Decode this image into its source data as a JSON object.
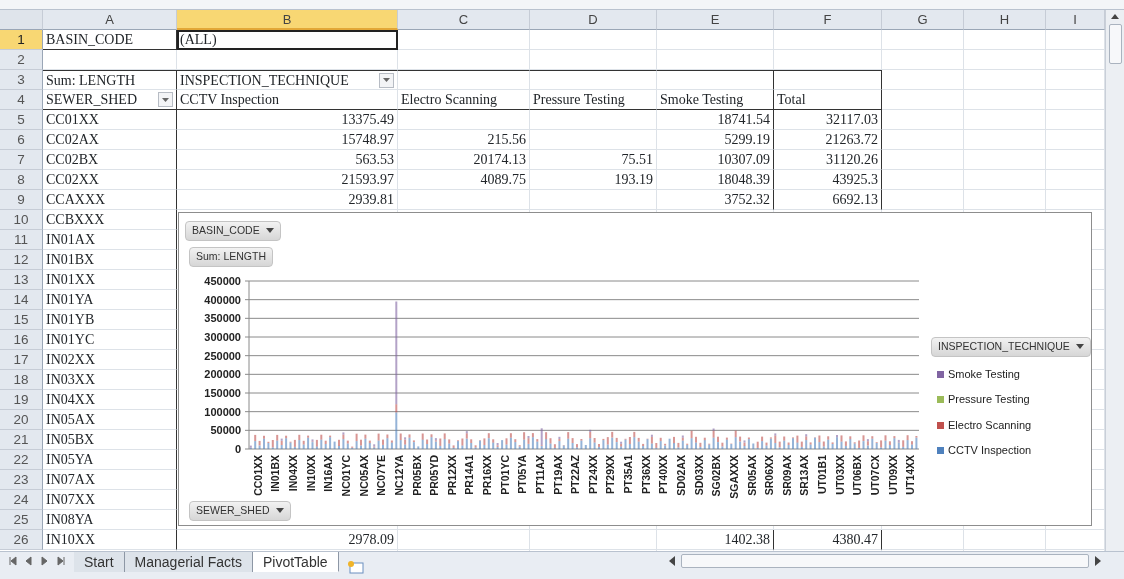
{
  "columns": [
    {
      "label": "A",
      "selected": false
    },
    {
      "label": "B",
      "selected": true
    },
    {
      "label": "C",
      "selected": false
    },
    {
      "label": "D",
      "selected": false
    },
    {
      "label": "E",
      "selected": false
    },
    {
      "label": "F",
      "selected": false
    },
    {
      "label": "G",
      "selected": false
    },
    {
      "label": "H",
      "selected": false
    },
    {
      "label": "I",
      "selected": false
    }
  ],
  "rows": [
    {
      "number": "1",
      "selected": true,
      "cells": [
        {
          "kind": "text",
          "text": "BASIN_CODE"
        },
        {
          "kind": "text",
          "text": "(ALL)"
        }
      ]
    },
    {
      "number": "2",
      "selected": false,
      "cells": []
    },
    {
      "number": "3",
      "selected": false,
      "cells": [
        {
          "kind": "text",
          "text": "Sum: LENGTH"
        },
        {
          "kind": "text",
          "text": "INSPECTION_TECHNIQUE",
          "filter": true
        }
      ]
    },
    {
      "number": "4",
      "selected": false,
      "cells": [
        {
          "kind": "text",
          "text": "SEWER_SHED",
          "filter": true
        },
        {
          "kind": "text",
          "text": "CCTV Inspection"
        },
        {
          "kind": "text",
          "text": "Electro Scanning"
        },
        {
          "kind": "text",
          "text": "Pressure Testing"
        },
        {
          "kind": "text",
          "text": "Smoke Testing"
        },
        {
          "kind": "text",
          "text": "Total"
        }
      ]
    },
    {
      "number": "5",
      "selected": false,
      "cells": [
        {
          "kind": "text",
          "text": "CC01XX"
        },
        {
          "kind": "number",
          "text": "13375.49"
        },
        {
          "kind": "blank"
        },
        {
          "kind": "blank"
        },
        {
          "kind": "number",
          "text": "18741.54"
        },
        {
          "kind": "number",
          "text": "32117.03"
        }
      ]
    },
    {
      "number": "6",
      "selected": false,
      "cells": [
        {
          "kind": "text",
          "text": "CC02AX"
        },
        {
          "kind": "number",
          "text": "15748.97"
        },
        {
          "kind": "number",
          "text": "215.56"
        },
        {
          "kind": "blank"
        },
        {
          "kind": "number",
          "text": "5299.19"
        },
        {
          "kind": "number",
          "text": "21263.72"
        }
      ]
    },
    {
      "number": "7",
      "selected": false,
      "cells": [
        {
          "kind": "text",
          "text": "CC02BX"
        },
        {
          "kind": "number",
          "text": "563.53"
        },
        {
          "kind": "number",
          "text": "20174.13"
        },
        {
          "kind": "number",
          "text": "75.51"
        },
        {
          "kind": "number",
          "text": "10307.09"
        },
        {
          "kind": "number",
          "text": "31120.26"
        }
      ]
    },
    {
      "number": "8",
      "selected": false,
      "cells": [
        {
          "kind": "text",
          "text": "CC02XX"
        },
        {
          "kind": "number",
          "text": "21593.97"
        },
        {
          "kind": "number",
          "text": "4089.75"
        },
        {
          "kind": "number",
          "text": "193.19"
        },
        {
          "kind": "number",
          "text": "18048.39"
        },
        {
          "kind": "number",
          "text": "43925.3"
        }
      ]
    },
    {
      "number": "9",
      "selected": false,
      "cells": [
        {
          "kind": "text",
          "text": "CCAXXX"
        },
        {
          "kind": "number",
          "text": "2939.81"
        },
        {
          "kind": "blank"
        },
        {
          "kind": "blank"
        },
        {
          "kind": "number",
          "text": "3752.32"
        },
        {
          "kind": "number",
          "text": "6692.13"
        }
      ]
    },
    {
      "number": "10",
      "selected": false,
      "cells": [
        {
          "kind": "text",
          "text": "CCBXXX"
        }
      ]
    },
    {
      "number": "11",
      "selected": false,
      "cells": [
        {
          "kind": "text",
          "text": "IN01AX"
        }
      ]
    },
    {
      "number": "12",
      "selected": false,
      "cells": [
        {
          "kind": "text",
          "text": "IN01BX"
        }
      ]
    },
    {
      "number": "13",
      "selected": false,
      "cells": [
        {
          "kind": "text",
          "text": "IN01XX"
        }
      ]
    },
    {
      "number": "14",
      "selected": false,
      "cells": [
        {
          "kind": "text",
          "text": "IN01YA"
        }
      ]
    },
    {
      "number": "15",
      "selected": false,
      "cells": [
        {
          "kind": "text",
          "text": "IN01YB"
        }
      ]
    },
    {
      "number": "16",
      "selected": false,
      "cells": [
        {
          "kind": "text",
          "text": "IN01YC"
        }
      ]
    },
    {
      "number": "17",
      "selected": false,
      "cells": [
        {
          "kind": "text",
          "text": "IN02XX"
        }
      ]
    },
    {
      "number": "18",
      "selected": false,
      "cells": [
        {
          "kind": "text",
          "text": "IN03XX"
        }
      ]
    },
    {
      "number": "19",
      "selected": false,
      "cells": [
        {
          "kind": "text",
          "text": "IN04XX"
        }
      ]
    },
    {
      "number": "20",
      "selected": false,
      "cells": [
        {
          "kind": "text",
          "text": "IN05AX"
        }
      ]
    },
    {
      "number": "21",
      "selected": false,
      "cells": [
        {
          "kind": "text",
          "text": "IN05BX"
        }
      ]
    },
    {
      "number": "22",
      "selected": false,
      "cells": [
        {
          "kind": "text",
          "text": "IN05YA"
        }
      ]
    },
    {
      "number": "23",
      "selected": false,
      "cells": [
        {
          "kind": "text",
          "text": "IN07AX"
        }
      ]
    },
    {
      "number": "24",
      "selected": false,
      "cells": [
        {
          "kind": "text",
          "text": "IN07XX"
        }
      ]
    },
    {
      "number": "25",
      "selected": false,
      "cells": [
        {
          "kind": "text",
          "text": "IN08YA"
        }
      ]
    },
    {
      "number": "26",
      "selected": false,
      "cells": [
        {
          "kind": "text",
          "text": "IN10XX"
        },
        {
          "kind": "number",
          "text": "2978.09"
        },
        {
          "kind": "blank"
        },
        {
          "kind": "blank"
        },
        {
          "kind": "number",
          "text": "1402.38"
        },
        {
          "kind": "number",
          "text": "4380.47"
        }
      ]
    }
  ],
  "chart": {
    "report_filter": "BASIN_CODE",
    "value_field": "Sum: LENGTH",
    "axis_field": "SEWER_SHED",
    "legend_field": "INSPECTION_TECHNIQUE",
    "yticks": [
      "450000",
      "400000",
      "350000",
      "300000",
      "250000",
      "200000",
      "150000",
      "100000",
      "50000",
      "0"
    ],
    "categories": [
      "CC01XX",
      "IN01BX",
      "IN04XX",
      "IN10XX",
      "IN16AX",
      "NC01YC",
      "NC05AX",
      "NC07YE",
      "NC12YA",
      "PR05BX",
      "PR05YD",
      "PR12XX",
      "PR14A1",
      "PR16XX",
      "PT01YC",
      "PT05YA",
      "PT11AX",
      "PT19AX",
      "PT22AZ",
      "PT24XX",
      "PT29XX",
      "PT35A1",
      "PT36XX",
      "PT40XX",
      "SD02AX",
      "SD03XX",
      "SG02BX",
      "SGAXXX",
      "SR05AX",
      "SR06XX",
      "SR09AX",
      "SR13AX",
      "UT01B1",
      "UT03XX",
      "UT06BX",
      "UT07CX",
      "UT09XX",
      "UT14XX"
    ],
    "legend": [
      {
        "name": "Smoke Testing",
        "color": "#8064a2"
      },
      {
        "name": "Pressure Testing",
        "color": "#9bbb59"
      },
      {
        "name": "Electro Scanning",
        "color": "#c0504d"
      },
      {
        "name": "CCTV Inspection",
        "color": "#4f81bd"
      }
    ]
  },
  "sheet_tabs": [
    {
      "label": "Start",
      "selected": false
    },
    {
      "label": "Managerial Facts",
      "selected": false
    },
    {
      "label": "PivotTable",
      "selected": true
    }
  ]
}
